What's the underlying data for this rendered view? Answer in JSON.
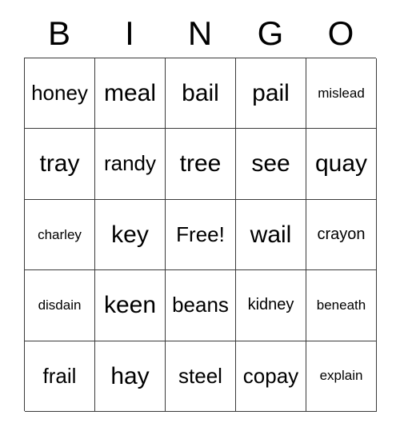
{
  "card": {
    "header_letters": [
      "B",
      "I",
      "N",
      "G",
      "O"
    ],
    "free_space_label": "Free!",
    "rows": [
      [
        "honey",
        "meal",
        "bail",
        "pail",
        "mislead"
      ],
      [
        "tray",
        "randy",
        "tree",
        "see",
        "quay"
      ],
      [
        "charley",
        "key",
        "Free!",
        "wail",
        "crayon"
      ],
      [
        "disdain",
        "keen",
        "beans",
        "kidney",
        "beneath"
      ],
      [
        "frail",
        "hay",
        "steel",
        "copay",
        "explain"
      ]
    ],
    "colors": {
      "background": "#ffffff",
      "text": "#000000",
      "grid_line": "#3a3a3a"
    }
  }
}
